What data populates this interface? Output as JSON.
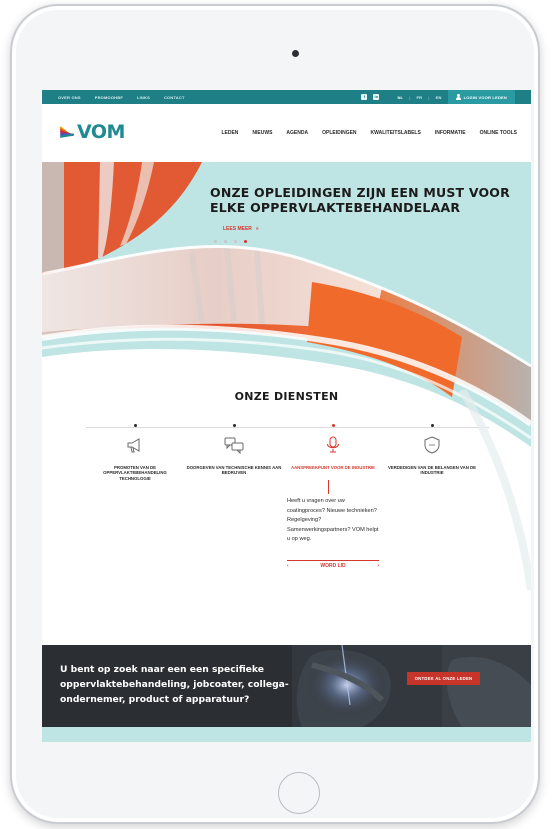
{
  "topbar": {
    "links": [
      "OVER ONS",
      "PROMOOHBF",
      "LINKS",
      "CONTACT"
    ],
    "languages": [
      "NL",
      "FR",
      "EN"
    ],
    "login_label": "LOGIN VOOR LEDEN",
    "social_icons": [
      "facebook-icon",
      "linkedin-icon"
    ]
  },
  "nav": {
    "logo_text": "VOM",
    "menu": [
      "LEDEN",
      "NIEUWS",
      "AGENDA",
      "OPLEIDINGEN",
      "KWALITEITSLABELS",
      "INFORMATIE",
      "ONLINE TOOLS"
    ]
  },
  "hero": {
    "title": "ONZE OPLEIDINGEN ZIJN EEN MUST VOOR ELKE OPPERVLAKTEBEHANDELAAR",
    "link_label": "LEES MEER",
    "link_arrow": "»",
    "slide_count": 4,
    "active_slide": 4
  },
  "services": {
    "title": "ONZE DIENSTEN",
    "items": [
      {
        "label": "PROMOTEN VAN DE OPPERVLAKTEBEHANDELING TECHNOLOGIE",
        "icon": "megaphone-icon",
        "active": false
      },
      {
        "label": "DOORGEVEN VAN TECHNISCHE KENNIS AAN BEDRIJVEN",
        "icon": "chat-bubbles-icon",
        "active": false
      },
      {
        "label": "AANSPREEKPUNT VOOR DE INDUSTRIE",
        "icon": "microphone-icon",
        "active": true
      },
      {
        "label": "VERDEDIGEN VAN DE BELANGEN VAN DE INDUSTRIE",
        "icon": "shield-icon",
        "active": false
      }
    ],
    "active_text": "Heeft u vragen over uw coatingproces? Nieuwe technieken? Regelgeving? Samenwerkingspartners? VOM helpt u op weg.",
    "cta_label": "WORD LID",
    "prev_arrow": "‹",
    "next_arrow": "›"
  },
  "banner": {
    "text": "U bent op zoek naar een een specifieke oppervlaktebehandeling, jobcoater, collega-ondernemer, product of apparatuur?",
    "button_label": "ONTDEK AL ONZE LEDEN"
  },
  "colors": {
    "teal": "#1f7f86",
    "accent_red": "#d6382c",
    "hero_bg": "#bfe4e4",
    "banner_bg": "#262a2e"
  }
}
